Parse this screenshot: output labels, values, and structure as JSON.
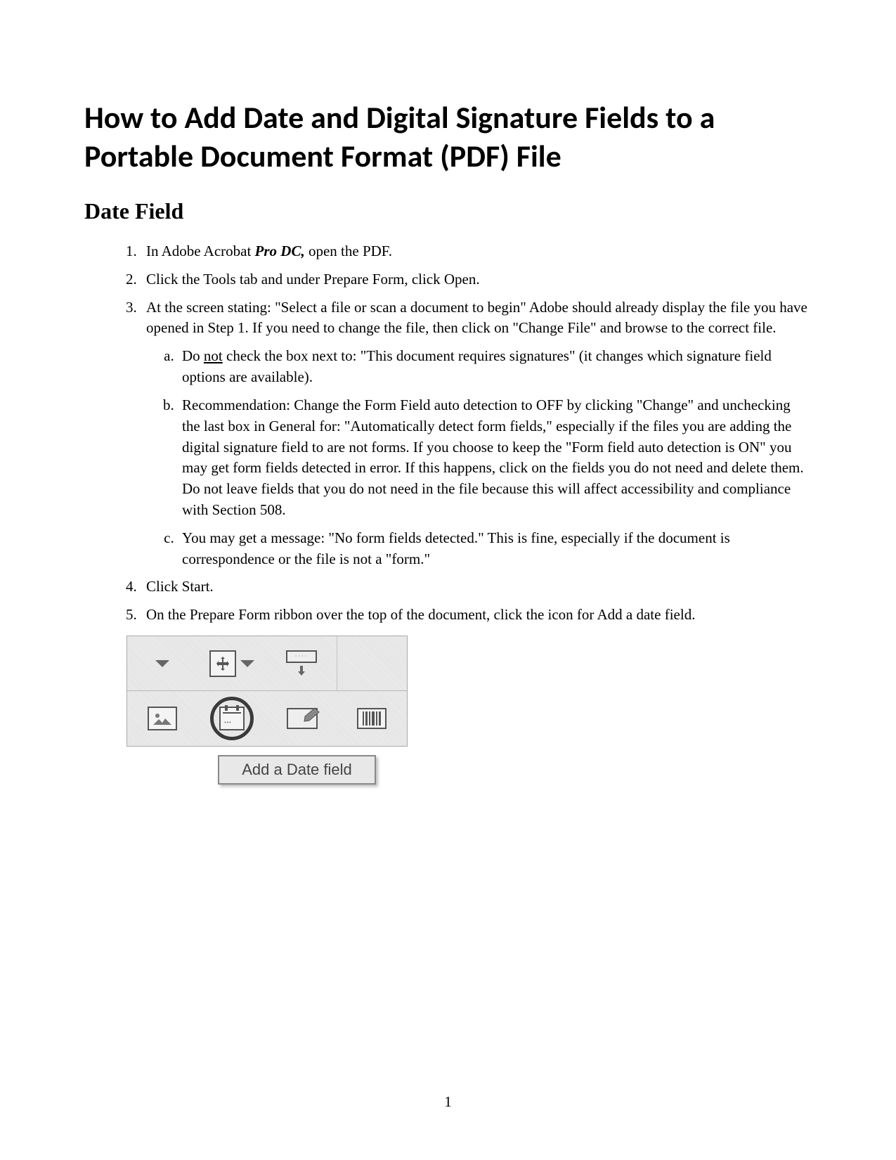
{
  "title": "How to Add Date and Digital Signature Fields to a Portable Document Format (PDF) File",
  "section": "Date Field",
  "steps": {
    "s1_pre": "In Adobe Acrobat ",
    "s1_em": "Pro DC,",
    "s1_post": " open the PDF.",
    "s2": "Click the Tools tab and under Prepare Form, click Open.",
    "s3": "At the screen stating: \"Select a file or scan a document to begin\" Adobe should already display the file you have opened in Step 1.  If you need to change the file, then click on \"Change File\" and browse to the correct file.",
    "s3a_pre": "Do ",
    "s3a_u": "not",
    "s3a_post": " check the box next to: \"This document requires signatures\" (it changes which signature field options are available).",
    "s3b": "Recommendation:  Change the Form Field auto detection to OFF by clicking \"Change\" and unchecking the last box in General for: \"Automatically detect form fields,\" especially if the files you are adding the digital signature field to are not forms.  If you choose to keep the \"Form field auto detection is ON\" you may get form fields detected in error.  If this happens, click on the fields you do not need and delete them.  Do not leave fields that you do not need in the file because this will affect accessibility and compliance with Section 508.",
    "s3c": "You may get a message: \"No form fields detected.\"  This is fine, especially if the document is correspondence or the file is not a \"form.\"",
    "s4": "Click Start.",
    "s5": "On the Prepare Form ribbon over the top of the document, click the icon for Add a date field."
  },
  "figure": {
    "tooltip": "Add a Date field"
  },
  "page_number": "1"
}
